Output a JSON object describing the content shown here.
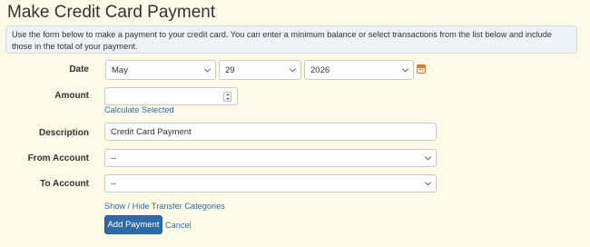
{
  "page": {
    "title": "Make Credit Card Payment",
    "info": "Use the form below to make a payment to your credit card. You can enter a minimum balance or select transactions from the list below and include those in the total of your payment."
  },
  "form": {
    "date_label": "Date",
    "date_month": "May",
    "date_day": "29",
    "date_year": "2026",
    "amount_label": "Amount",
    "amount_value": "",
    "calculate_link": "Calculate Selected",
    "description_label": "Description",
    "description_value": "Credit Card Payment",
    "from_label": "From Account",
    "from_value": "--",
    "to_label": "To Account",
    "to_value": "--",
    "toggle_link": "Show / Hide Transfer Categories",
    "submit_label": "Add Payment",
    "cancel_label": "Cancel"
  },
  "icons": {
    "calendar": "calendar-icon"
  },
  "colors": {
    "background": "#fdfbe8",
    "primary_button": "#2f6aa6",
    "link": "#2e6da4",
    "calendar": "#e07b2a"
  }
}
